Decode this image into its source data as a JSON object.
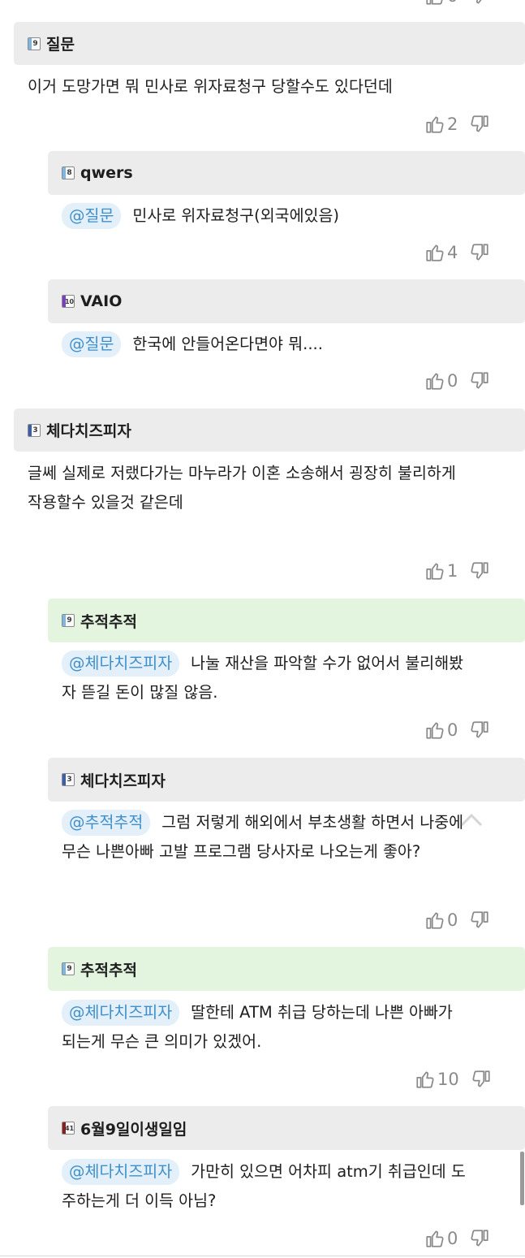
{
  "comments": [
    {
      "nick": "질문",
      "level": "9",
      "level_color": "#7db7e0",
      "text": "이거 도망가면 뭐 민사로 위자료청구 당할수도 있다던데",
      "likes": "2",
      "replies": [
        {
          "nick": "qwers",
          "level": "8",
          "level_color": "#7db7e0",
          "mention": "@질문",
          "text": "민사로 위자료청구(외국에있음)",
          "likes": "4"
        },
        {
          "nick": "VAIO",
          "level": "10",
          "level_color": "#7a3fc0",
          "mention": "@질문",
          "text": "한국에 안들어온다면야 뭐....",
          "likes": "0"
        }
      ]
    },
    {
      "nick": "체다치즈피자",
      "level": "3",
      "level_color": "#3a5ea8",
      "text_line1": "글쎄 실제로 저랬다가는 마누라가 이혼 소송해서 굉장히 불리하게",
      "text_line2": "작용할수 있을것 같은데",
      "likes": "1",
      "replies": [
        {
          "nick": "추적추적",
          "level": "9",
          "level_color": "#7db7e0",
          "mention": "@체다치즈피자",
          "text_line1": "나눌 재산을 파악할 수가 없어서 불리해봤",
          "text_line2": "자 뜯길 돈이 많질 않음.",
          "likes": "0"
        },
        {
          "nick": "체다치즈피자",
          "level": "3",
          "level_color": "#3a5ea8",
          "mention": "@추적추적",
          "text_line1": "그럼 저렇게 해외에서 부초생활 하면서 나중에",
          "text_line2": "무슨 나쁜아빠 고발 프로그램 당사자로 나오는게 좋아?",
          "likes": "0"
        },
        {
          "nick": "추적추적",
          "level": "9",
          "level_color": "#7db7e0",
          "mention": "@체다치즈피자",
          "text_line1": "딸한테 ATM 취급 당하는데 나쁜 아빠가",
          "text_line2": "되는게 무슨 큰 의미가 있겠어.",
          "likes": "10"
        },
        {
          "nick": "6월9일이생일임",
          "level": "41",
          "level_color": "#8b1e1e",
          "mention": "@체다치즈피자",
          "text_line1": "가만히 있으면 어차피 atm기 취급인데 도",
          "text_line2": "주하는게 더 이득 아님?",
          "likes": "0"
        }
      ]
    }
  ],
  "top_partial_vote": "0"
}
